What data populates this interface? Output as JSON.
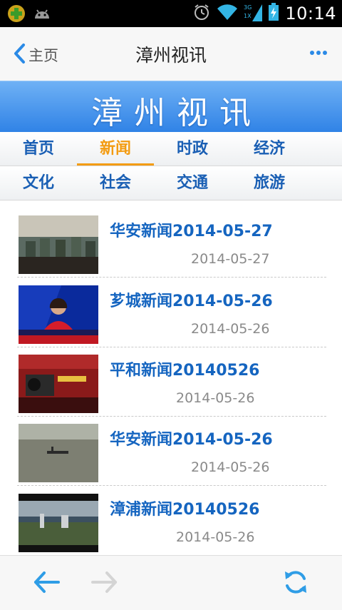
{
  "status_bar": {
    "time": "10:14",
    "icons": [
      "app-plus-icon",
      "android-icon",
      "alarm-icon",
      "wifi-icon",
      "signal-3g-icon",
      "battery-charging-icon"
    ]
  },
  "header": {
    "back_label": "主页",
    "title": "漳州视讯",
    "more_icon": "more-dots-icon"
  },
  "banner": {
    "text": "漳州视讯"
  },
  "categories": {
    "row1": [
      {
        "label": "首页"
      },
      {
        "label": "新闻",
        "active": true
      },
      {
        "label": "时政"
      },
      {
        "label": "经济"
      }
    ],
    "row2": [
      {
        "label": "文化"
      },
      {
        "label": "社会"
      },
      {
        "label": "交通"
      },
      {
        "label": "旅游"
      }
    ]
  },
  "news": [
    {
      "title": "华安新闻2014-05-27",
      "date": "2014-05-27"
    },
    {
      "title": "芗城新闻2014-05-26",
      "date": "2014-05-26"
    },
    {
      "title": "平和新闻20140526",
      "date": "2014-05-26"
    },
    {
      "title": "华安新闻2014-05-26",
      "date": "2014-05-26"
    },
    {
      "title": "漳浦新闻20140526",
      "date": "2014-05-26"
    }
  ],
  "bottom_bar": {
    "icons": [
      "back-arrow-icon",
      "forward-arrow-icon",
      "refresh-icon"
    ]
  },
  "colors": {
    "accent_blue": "#1565c0",
    "active_tab": "#f39c12",
    "banner_top": "#6fb1f5",
    "banner_bottom": "#2f82e6"
  }
}
